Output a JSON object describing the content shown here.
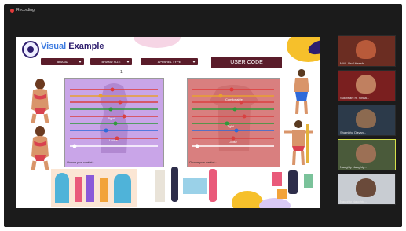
{
  "recording": {
    "label": "Recording"
  },
  "slide": {
    "title_word1": "Visual",
    "title_word2": "Example",
    "dropdowns": [
      "BRAND",
      "BRAND SIZE",
      "APPAREL TYPE"
    ],
    "user_code": "USER CODE",
    "page_number": "1",
    "comfort_label_left": "Choose your comfort :",
    "comfort_label_right": "Choose your comfort :",
    "tags": [
      "Tight",
      "Loose",
      "Comfortable"
    ]
  },
  "participants": [
    {
      "name": "MM - Prof.Harish...",
      "avatar_color": "#b85a3a",
      "bg": "#6b2d22"
    },
    {
      "name": "Sukhwani R. Sinha...",
      "avatar_color": "#c08060",
      "bg": "#7a1f1f"
    },
    {
      "name": "Shambhu Dayan...",
      "avatar_color": "#8c6a50",
      "bg": "#2c3a4a"
    },
    {
      "name": "Naughty Naughty...",
      "avatar_color": "#9c7055",
      "bg": "#4a5a3a"
    },
    {
      "name": "Naughty Naughty...",
      "avatar_color": "#6a4a3a",
      "bg": "#c8ccd2"
    }
  ],
  "colors": {
    "accent_dark": "#5a1c2a",
    "brand": "#2d1d6e",
    "highlight_border": "#d6e04a"
  }
}
